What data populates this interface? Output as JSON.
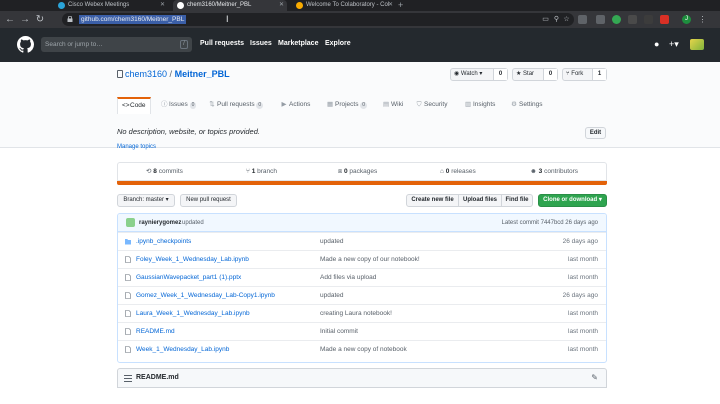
{
  "browser": {
    "tabs": [
      {
        "title": "Cisco Webex Meetings",
        "color": "#2aa4d9",
        "active": false
      },
      {
        "title": "chem3160/Meitner_PBL",
        "color": "#ffffff",
        "active": true
      },
      {
        "title": "Welcome To Colaboratory - Col",
        "color": "#f9ab00",
        "active": false
      }
    ],
    "url": "github.com/chem3160/Meitner_PBL",
    "profile_initial": "J"
  },
  "github": {
    "search_placeholder": "Search or jump to…",
    "slash_hint": "/",
    "nav": [
      "Pull requests",
      "Issues",
      "Marketplace",
      "Explore"
    ]
  },
  "repo": {
    "owner": "chem3160",
    "separator": "/",
    "name": "Meitner_PBL",
    "watch_label": "Watch",
    "watch_count": "0",
    "star_label": "Star",
    "star_count": "0",
    "fork_label": "Fork",
    "fork_count": "1",
    "tabs": [
      {
        "label": "Code",
        "count": "",
        "icon": "code-icon"
      },
      {
        "label": "Issues",
        "count": "0",
        "icon": "issue-icon"
      },
      {
        "label": "Pull requests",
        "count": "0",
        "icon": "pull-request-icon"
      },
      {
        "label": "Actions",
        "count": "",
        "icon": "actions-icon"
      },
      {
        "label": "Projects",
        "count": "0",
        "icon": "projects-icon"
      },
      {
        "label": "Wiki",
        "count": "",
        "icon": "wiki-icon"
      },
      {
        "label": "Security",
        "count": "",
        "icon": "security-icon"
      },
      {
        "label": "Insights",
        "count": "",
        "icon": "insights-icon"
      },
      {
        "label": "Settings",
        "count": "",
        "icon": "gear-icon"
      }
    ],
    "description": "No description, website, or topics provided.",
    "edit_label": "Edit",
    "manage_topics": "Manage topics",
    "stats": {
      "commits_num": "8",
      "commits_label": "commits",
      "branch_num": "1",
      "branch_label": "branch",
      "packages_num": "0",
      "packages_label": "packages",
      "releases_num": "0",
      "releases_label": "releases",
      "contributors_num": "3",
      "contributors_label": "contributors"
    },
    "language_color": "#e36209",
    "branch_button": "Branch: master ▾",
    "new_pr": "New pull request",
    "create_file": "Create new file",
    "upload_files": "Upload files",
    "find_file": "Find file",
    "clone": "Clone or download ▾",
    "latest_commit": {
      "author": "raynierygomez",
      "message": "updated",
      "summary": "Latest commit 7447bcd 26 days ago"
    },
    "files": [
      {
        "name": ".ipynb_checkpoints",
        "message": "updated",
        "age": "26 days ago",
        "type": "folder"
      },
      {
        "name": "Foley_Week_1_Wednesday_Lab.ipynb",
        "message": "Made a new copy of our notebook!",
        "age": "last month",
        "type": "file"
      },
      {
        "name": "GaussianWavepacket_part1 (1).pptx",
        "message": "Add files via upload",
        "age": "last month",
        "type": "file"
      },
      {
        "name": "Gomez_Week_1_Wednesday_Lab-Copy1.ipynb",
        "message": "updated",
        "age": "26 days ago",
        "type": "file"
      },
      {
        "name": "Laura_Week_1_Wednesday_Lab.ipynb",
        "message": "creating Laura notebook!",
        "age": "last month",
        "type": "file"
      },
      {
        "name": "README.md",
        "message": "Initial commit",
        "age": "last month",
        "type": "file"
      },
      {
        "name": "Week_1_Wednesday_Lab.ipynb",
        "message": "Made a new copy of notebook",
        "age": "last month",
        "type": "file"
      }
    ],
    "readme_title": "README.md"
  }
}
